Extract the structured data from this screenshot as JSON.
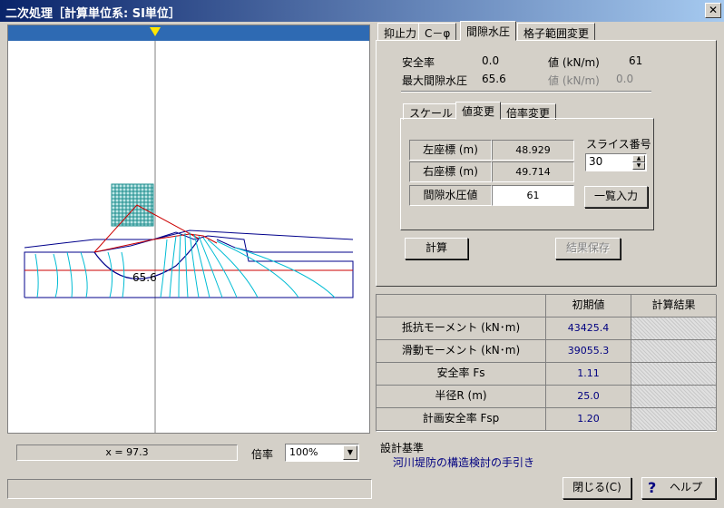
{
  "window": {
    "title": "二次処理［計算単位系: SI単位］",
    "close_glyph": "✕"
  },
  "left": {
    "plot_label": "65.6",
    "x_readout": "x =    97.3",
    "scale_label": "倍率",
    "scale_value": "100%"
  },
  "tabs": [
    {
      "label": "抑止力"
    },
    {
      "label": "C－φ"
    },
    {
      "label": "間隙水圧"
    },
    {
      "label": "格子範囲変更"
    }
  ],
  "summary": {
    "safety_label": "安全率",
    "safety_value": "0.0",
    "value_label": "値 (kN/m)",
    "value_value": "61",
    "max_pressure_label": "最大間隙水圧",
    "max_pressure_value": "65.6",
    "value2_label": "値 (kN/m)",
    "value2_value": "0.0"
  },
  "subtabs": [
    {
      "label": "スケール"
    },
    {
      "label": "値変更"
    },
    {
      "label": "倍率変更"
    }
  ],
  "grid": [
    {
      "label": "左座標 (m)",
      "value": "48.929"
    },
    {
      "label": "右座標 (m)",
      "value": "49.714"
    },
    {
      "label": "間隙水圧値",
      "value": "61"
    }
  ],
  "slice": {
    "label": "スライス番号",
    "value": "30"
  },
  "buttons": {
    "bulk_input": "一覧入力",
    "calc": "計算",
    "save_result": "結果保存",
    "close": "閉じる(C)",
    "help": "ヘルプ"
  },
  "results": {
    "headers": [
      "初期値",
      "計算結果"
    ],
    "rows": [
      {
        "label": "抵抗モーメント (kN･m)",
        "initial": "43425.4",
        "result": ""
      },
      {
        "label": "滑動モーメント (kN･m)",
        "initial": "39055.3",
        "result": ""
      },
      {
        "label": "安全率 Fs",
        "initial": "1.11",
        "result": ""
      },
      {
        "label": "半径R (m)",
        "initial": "25.0",
        "result": ""
      },
      {
        "label": "計画安全率 Fsp",
        "initial": "1.20",
        "result": ""
      }
    ]
  },
  "design": {
    "label": "設計基準",
    "value": "河川堤防の構造検討の手引き"
  },
  "colors": {
    "accent": "#0a246a",
    "canvas_bar": "#2e6ab3",
    "marker": "#ffe600",
    "mesh": "#1a8c8c",
    "slip": "#cc0000",
    "water": "#00bcd4",
    "ground": "#00008b"
  }
}
